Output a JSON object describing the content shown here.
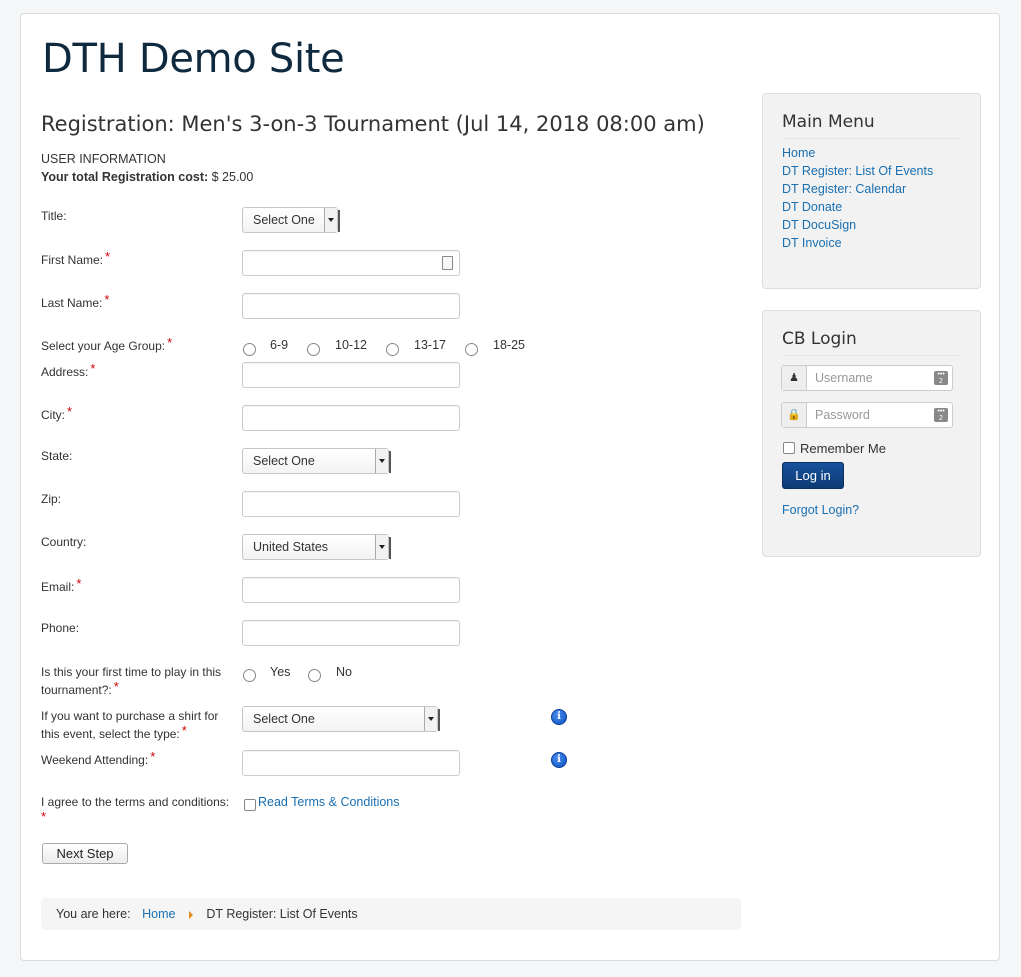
{
  "site": {
    "title": "DTH Demo Site"
  },
  "registration": {
    "title": "Registration: Men's 3-on-3 Tournament (Jul 14, 2018 08:00 am)",
    "section": "USER INFORMATION",
    "cost_label": "Your total Registration cost:",
    "cost_value": "$ 25.00"
  },
  "form": {
    "title_label": "Title:",
    "title_select": "Select One",
    "first_name_label": "First Name:",
    "last_name_label": "Last Name:",
    "age_group_label": "Select your Age Group:",
    "age_groups": [
      "6-9",
      "10-12",
      "13-17",
      "18-25"
    ],
    "address_label": "Address:",
    "city_label": "City:",
    "state_label": "State:",
    "state_select": "Select One",
    "zip_label": "Zip:",
    "country_label": "Country:",
    "country_select": "United States",
    "email_label": "Email:",
    "phone_label": "Phone:",
    "first_time_label_1": "Is this your first time to play in this",
    "first_time_label_2": "tournament?:",
    "first_time_options": [
      "Yes",
      "No"
    ],
    "shirt_label_1": "If you want to purchase a shirt for",
    "shirt_label_2": "this event, select the type:",
    "shirt_select": "Select One",
    "weekend_label": "Weekend Attending:",
    "terms_label": "I agree to the terms and conditions:",
    "terms_link": "Read Terms & Conditions",
    "required_mark": "*",
    "next_button": "Next Step"
  },
  "breadcrumb": {
    "prefix": "You are here:",
    "home": "Home",
    "current": "DT Register: List Of Events"
  },
  "main_menu": {
    "title": "Main Menu",
    "items": [
      "Home",
      "DT Register: List Of Events",
      "DT Register: Calendar",
      "DT Donate",
      "DT DocuSign",
      "DT Invoice"
    ]
  },
  "cb_login": {
    "title": "CB Login",
    "username_placeholder": "Username",
    "password_placeholder": "Password",
    "remember_me": "Remember Me",
    "login_button": "Log in",
    "forgot_link": "Forgot Login?"
  },
  "colors": {
    "link": "#1a6fb0",
    "required": "#cc0000",
    "button_primary": "#0d3b73",
    "breadcrumb_arrow": "#e08a1e"
  },
  "icons": [
    "user-icon",
    "lock-icon",
    "info-icon",
    "contact-card-icon",
    "password-manager-icon"
  ]
}
